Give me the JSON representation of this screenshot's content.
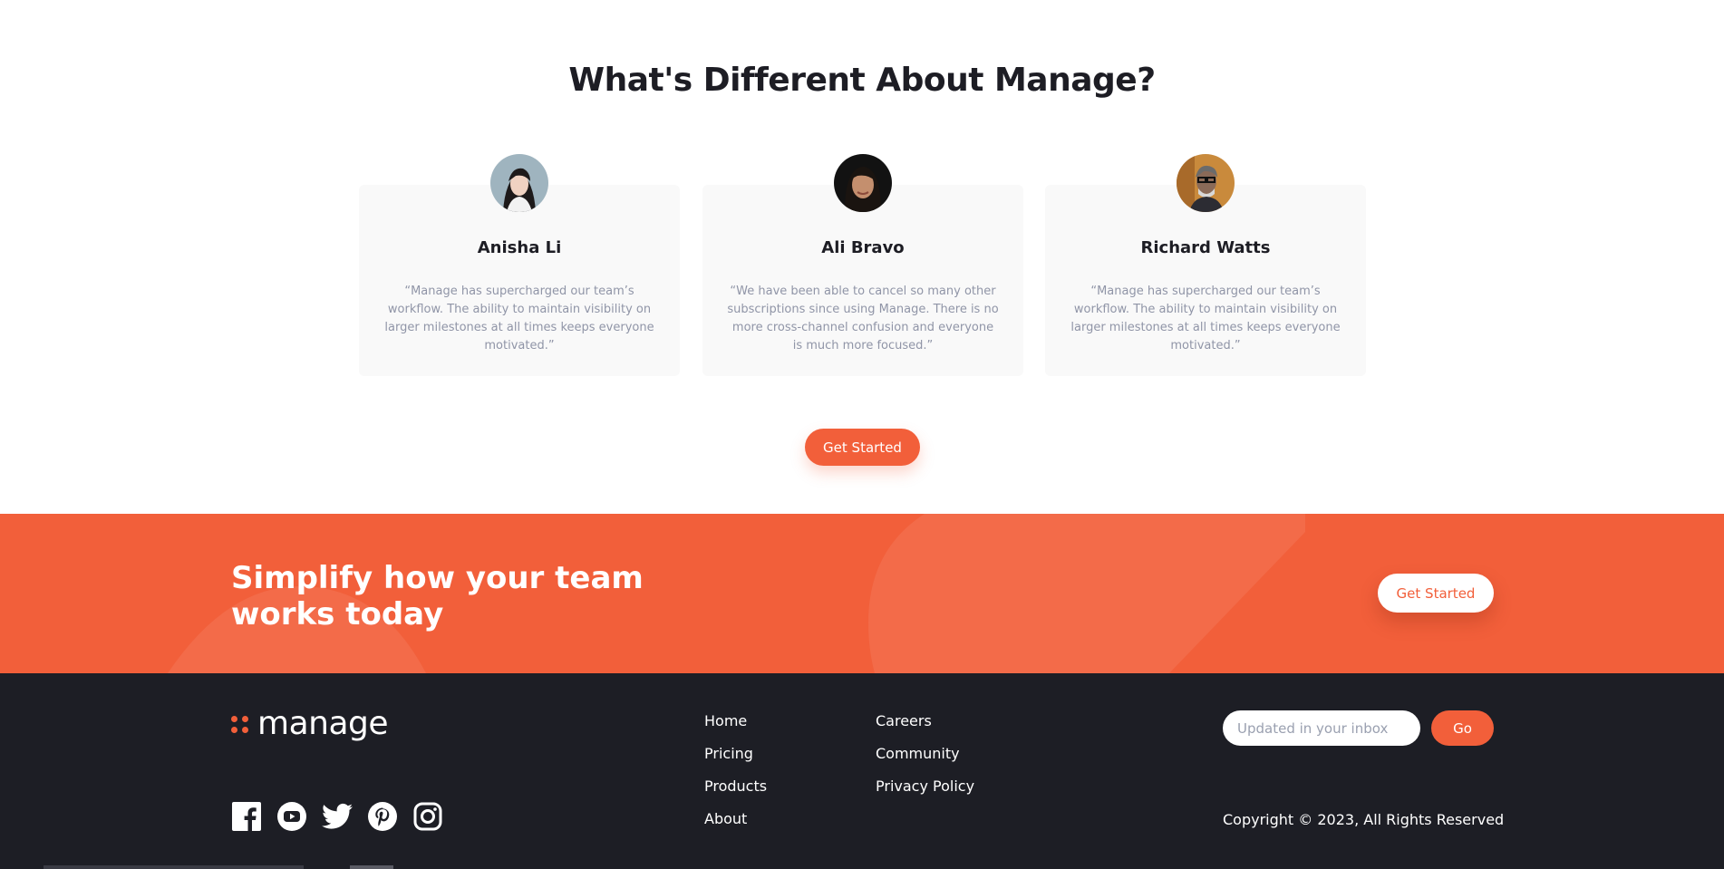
{
  "section": {
    "title": "What's Different About Manage?"
  },
  "testimonials": [
    {
      "name": "Anisha Li",
      "quote": "“Manage has supercharged our team’s workflow. The ability to maintain visibility on larger milestones at all times keeps everyone motivated.”"
    },
    {
      "name": "Ali Bravo",
      "quote": "“We have been able to cancel so many other subscriptions since using Manage. There is no more cross-channel confusion and everyone is much more focused.”"
    },
    {
      "name": "Richard Watts",
      "quote": "“Manage has supercharged our team’s workflow. The ability to maintain visibility on larger milestones at all times keeps everyone motivated.”"
    }
  ],
  "primary_cta": {
    "label": "Get Started"
  },
  "cta_band": {
    "title": "Simplify how your team works today",
    "button_label": "Get Started"
  },
  "footer": {
    "logo_text": "manage",
    "nav_col1": [
      "Home",
      "Pricing",
      "Products",
      "About"
    ],
    "nav_col2": [
      "Careers",
      "Community",
      "Privacy Policy"
    ],
    "subscribe": {
      "placeholder": "Updated in your inbox",
      "button_label": "Go"
    },
    "copyright": "Copyright © 2023, All Rights Reserved",
    "socials": [
      "facebook-icon",
      "youtube-icon",
      "twitter-icon",
      "pinterest-icon",
      "instagram-icon"
    ]
  },
  "colors": {
    "accent": "#f25f3a",
    "dark": "#1d1e25",
    "card_bg": "#f9f9f9",
    "quote_text": "#9095a7"
  }
}
